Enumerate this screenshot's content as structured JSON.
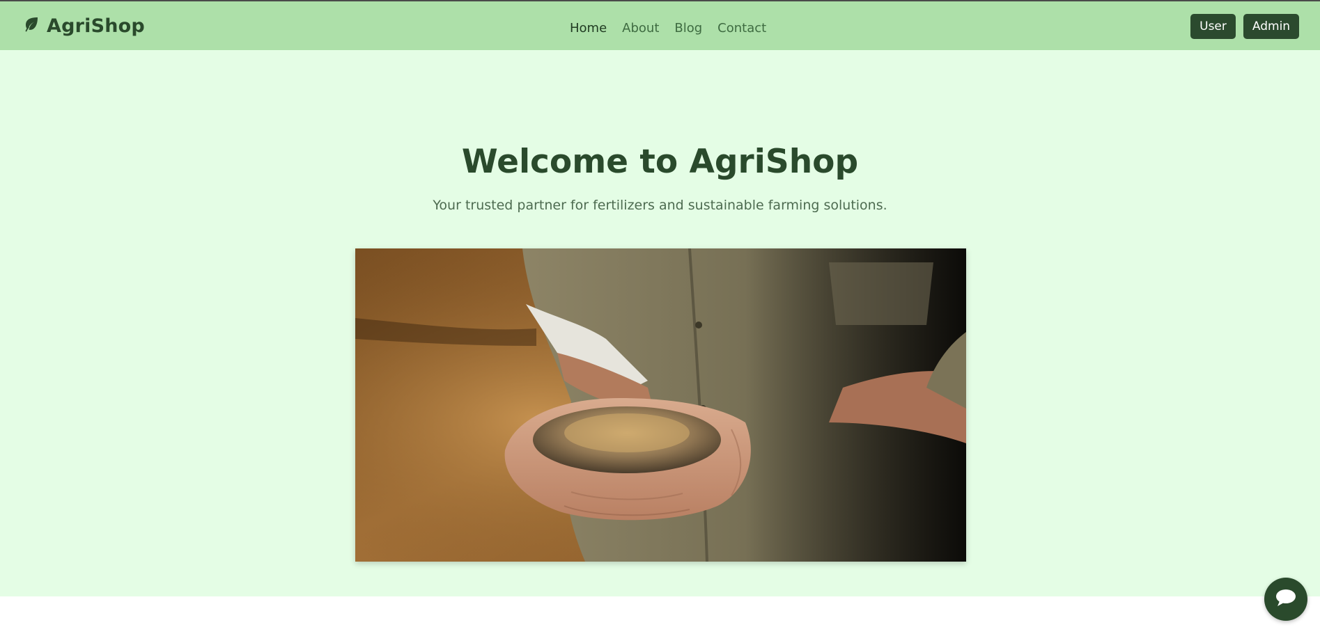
{
  "brand": {
    "name": "AgriShop",
    "icon": "leaf-icon"
  },
  "nav": {
    "links": [
      "Home",
      "About",
      "Blog",
      "Contact"
    ],
    "active": "Home"
  },
  "auth": {
    "user_label": "User",
    "admin_label": "Admin"
  },
  "hero": {
    "title": "Welcome to AgriShop",
    "subtitle": "Your trusted partner for fertilizers and sustainable farming solutions.",
    "image_alt": "Farmer holding a handful of fertilizer granules"
  },
  "chat": {
    "icon": "chat-bubble-icon"
  },
  "colors": {
    "navbar": "#ade0a9",
    "hero_bg": "#e4fde5",
    "brand_dark": "#2a4a2c",
    "button": "#2b4a2e",
    "link": "#3e6b41"
  }
}
